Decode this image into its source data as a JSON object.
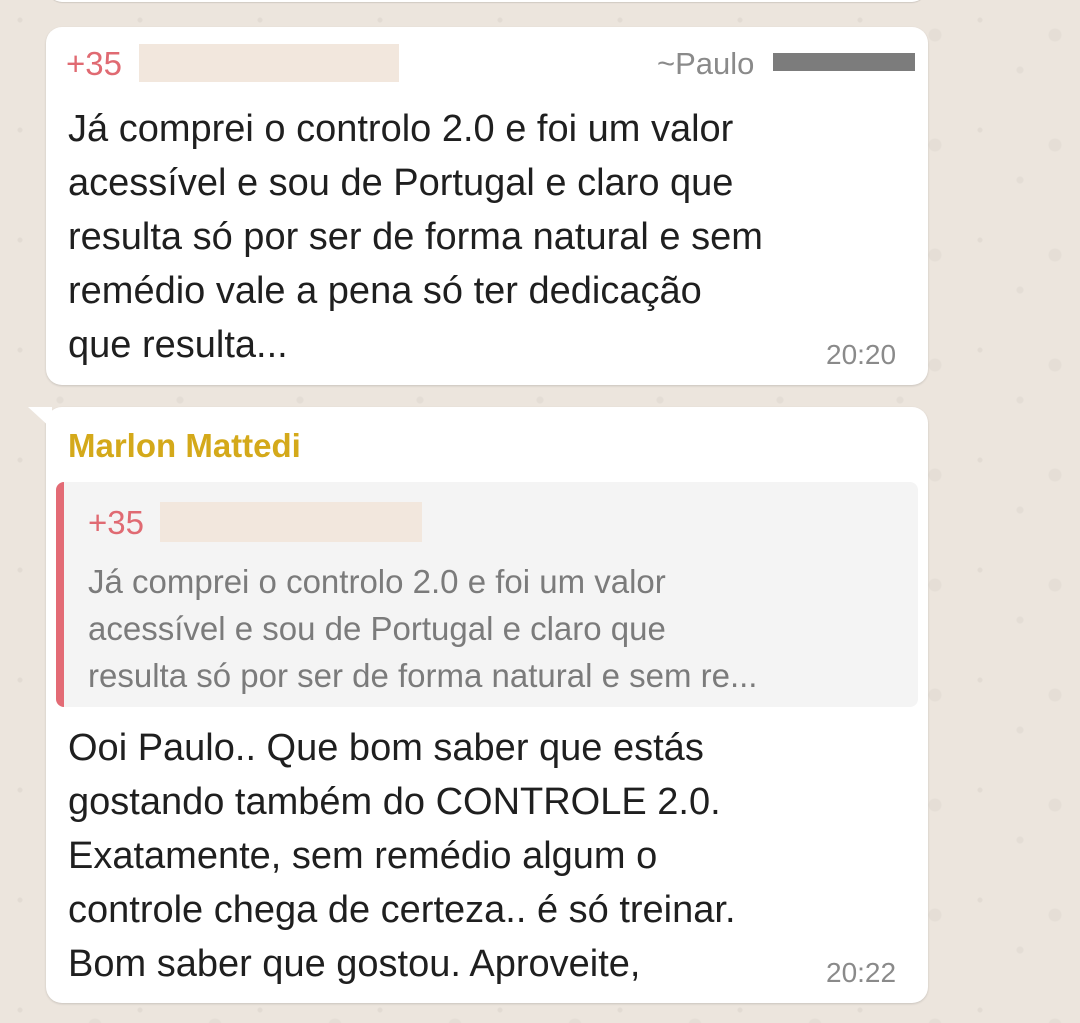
{
  "messages": [
    {
      "sender_number": "+35",
      "push_name": "~Paulo",
      "text": "Já comprei o controlo 2.0 e foi um valor\nacessível  e sou de Portugal e claro que\nresulta só por ser de forma natural e sem\nremédio vale a pena só ter dedicação\nque resulta...",
      "time": "20:20"
    },
    {
      "sender_name": "Marlon Mattedi",
      "quoted": {
        "sender_number": "+35",
        "text": "Já comprei o controlo 2.0 e foi um valor\nacessível  e sou de Portugal e claro que\nresulta só por ser de forma natural e sem re..."
      },
      "text": "Ooi Paulo.. Que bom saber que estás\ngostando também do CONTROLE 2.0.\nExatamente, sem remédio algum o\ncontrole chega de certeza.. é só treinar.\nBom saber que gostou. Aproveite,",
      "time": "20:22"
    }
  ],
  "colors": {
    "wallpaper": "#ece5dd",
    "bubble": "#ffffff",
    "number_red": "#e06a72",
    "sender_gold": "#d4a91a",
    "quote_bar": "#e36b75",
    "meta_gray": "#8a8a8a"
  }
}
